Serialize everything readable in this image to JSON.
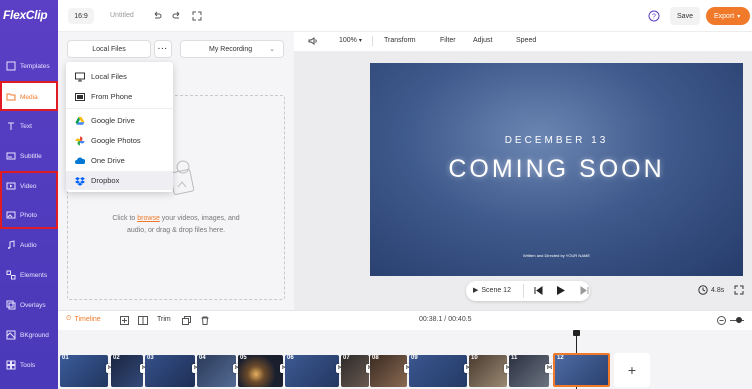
{
  "app": {
    "logo": "FlexClip"
  },
  "sidebar": {
    "items": [
      {
        "label": "Templates"
      },
      {
        "label": "Media"
      },
      {
        "label": "Text"
      },
      {
        "label": "Subtitle"
      },
      {
        "label": "Video"
      },
      {
        "label": "Photo"
      },
      {
        "label": "Audio"
      },
      {
        "label": "Elements"
      },
      {
        "label": "Overlays"
      },
      {
        "label": "BKground"
      },
      {
        "label": "Tools"
      }
    ]
  },
  "topbar": {
    "aspect": "16:9",
    "title": "Untitled",
    "save": "Save",
    "export": "Export"
  },
  "media_panel": {
    "tab_local": "Local Files",
    "tab_recording": "My Recording",
    "drop_prefix": "Click to ",
    "drop_link": "browse",
    "drop_suffix": " your videos, images, and audio, or drag & drop files here."
  },
  "source_menu": [
    {
      "label": "Local Files",
      "icon": "monitor-icon"
    },
    {
      "label": "From Phone",
      "icon": "phone-icon"
    },
    {
      "label": "Google Drive",
      "icon": "google-drive-icon"
    },
    {
      "label": "Google Photos",
      "icon": "google-photos-icon"
    },
    {
      "label": "One Drive",
      "icon": "onedrive-icon"
    },
    {
      "label": "Dropbox",
      "icon": "dropbox-icon"
    }
  ],
  "editor_toolbar": {
    "zoom": "100%",
    "transform": "Transform",
    "filter": "Filter",
    "adjust": "Adjust",
    "speed": "Speed"
  },
  "preview": {
    "date": "DECEMBER 13",
    "title": "COMING SOON",
    "credit": "Written and Directed by YOUR NAME"
  },
  "playback": {
    "scene": "Scene 12",
    "duration": "4.8s"
  },
  "timeline": {
    "tab": "Timeline",
    "trim": "Trim",
    "time": "00:38.1 / 00:40.5"
  },
  "clips": [
    "01",
    "02",
    "03",
    "04",
    "05",
    "06",
    "07",
    "08",
    "09",
    "10",
    "11",
    "12"
  ],
  "colors": {
    "accent": "#f07a2a",
    "sidebar": "#4f3bbd",
    "highlight": "#e01b24"
  }
}
